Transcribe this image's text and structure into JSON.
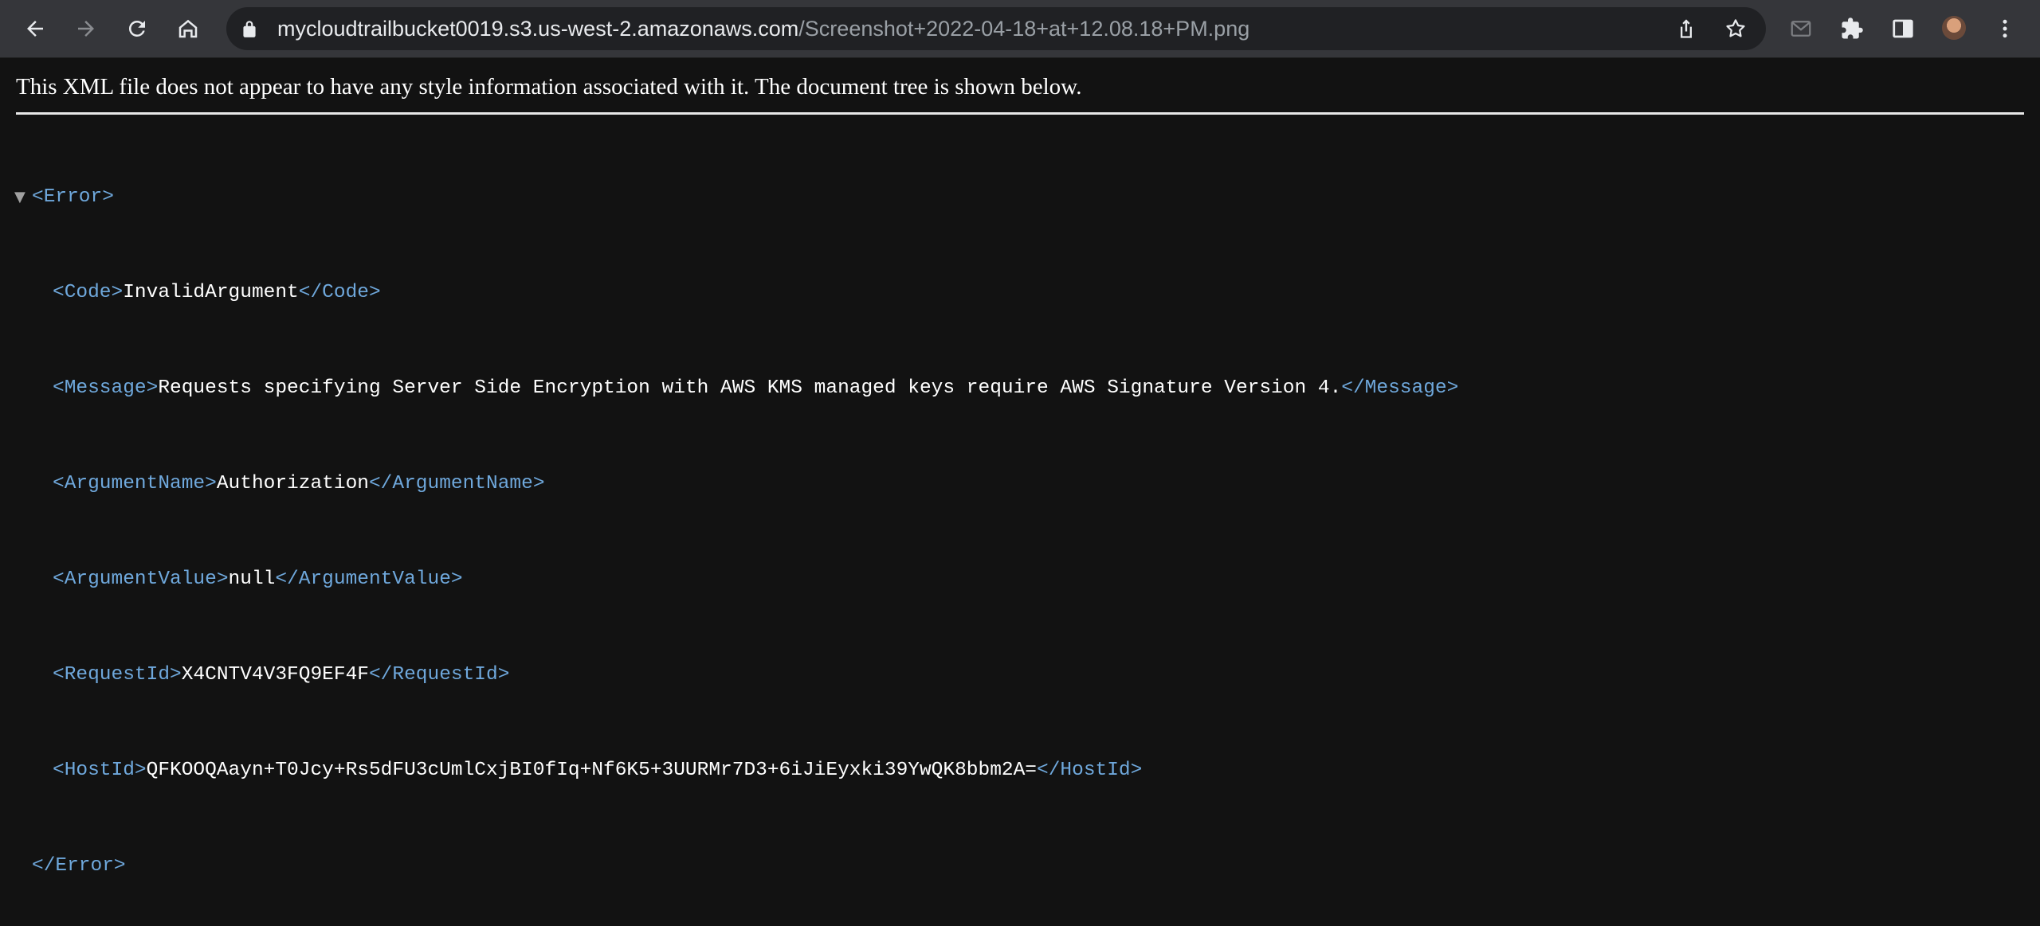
{
  "browser": {
    "url_host": "mycloudtrailbucket0019.s3.us-west-2.amazonaws.com",
    "url_path": "/Screenshot+2022-04-18+at+12.08.18+PM.png",
    "icons": {
      "back": "back-arrow-icon",
      "forward": "forward-arrow-icon",
      "reload": "reload-icon",
      "home": "home-icon",
      "lock": "lock-icon",
      "share": "share-icon",
      "bookmark": "star-icon",
      "mail": "mail-icon",
      "extensions": "puzzle-icon",
      "side_panel": "side-panel-icon",
      "profile": "avatar",
      "menu": "kebab-menu-icon"
    }
  },
  "viewer": {
    "notice": "This XML file does not appear to have any style information associated with it. The document tree is shown below."
  },
  "xml": {
    "root_open": "<Error>",
    "root_close": "</Error>",
    "code": {
      "open": "<Code>",
      "value": "InvalidArgument",
      "close": "</Code>"
    },
    "message": {
      "open": "<Message>",
      "value": "Requests specifying Server Side Encryption with AWS KMS managed keys require AWS Signature Version 4.",
      "close": "</Message>"
    },
    "argument_name": {
      "open": "<ArgumentName>",
      "value": "Authorization",
      "close": "</ArgumentName>"
    },
    "argument_value": {
      "open": "<ArgumentValue>",
      "value": "null",
      "close": "</ArgumentValue>"
    },
    "request_id": {
      "open": "<RequestId>",
      "value": "X4CNTV4V3FQ9EF4F",
      "close": "</RequestId>"
    },
    "host_id": {
      "open": "<HostId>",
      "value": "QFKOOQAayn+T0Jcy+Rs5dFU3cUmlCxjBI0fIq+Nf6K5+3UURMr7D3+6iJiEyxki39YwQK8bbm2A=",
      "close": "</HostId>"
    }
  },
  "colors": {
    "toolbar_bg": "#35363a",
    "omnibox_bg": "#202124",
    "page_bg": "#121212",
    "xml_tag": "#6fa8dc",
    "text": "#ffffff"
  }
}
